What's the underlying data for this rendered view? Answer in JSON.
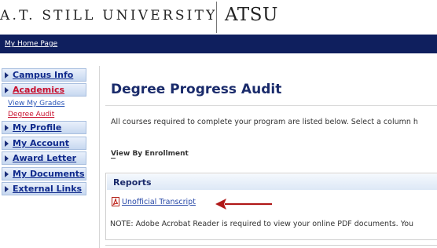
{
  "header": {
    "university_name": "A.T. STILL UNIVERSITY",
    "logo_text": "ATSU"
  },
  "topbar": {
    "home_link": "My Home Page",
    "bg_color": "#0f1f5e"
  },
  "sidebar": {
    "items": [
      {
        "label": "Campus Info",
        "active": false
      },
      {
        "label": "Academics",
        "active": true
      },
      {
        "label": "My Profile",
        "active": false
      },
      {
        "label": "My Account",
        "active": false
      },
      {
        "label": "Award Letter",
        "active": false
      },
      {
        "label": "My Documents",
        "active": false
      },
      {
        "label": "External Links",
        "active": false
      }
    ],
    "sub_items": [
      {
        "label": "View My Grades",
        "active": false
      },
      {
        "label": "Degree Audit",
        "active": true
      }
    ]
  },
  "main": {
    "title": "Degree Progress Audit",
    "intro": "All courses required to complete your program are listed below. Select a column h",
    "view_by": "View By Enrollment",
    "reports": {
      "title": "Reports",
      "link": "Unofficial Transcript",
      "note": "NOTE: Adobe Acrobat Reader is required to view your online PDF documents. You"
    }
  },
  "colors": {
    "accent_red": "#c8102e",
    "link_blue": "#2a4aa8",
    "navy": "#1a2b6b"
  },
  "icons": {
    "pdf": "pdf-file-icon",
    "nav_arrow": "triangle-right-icon",
    "annotation": "red-arrow-icon"
  }
}
